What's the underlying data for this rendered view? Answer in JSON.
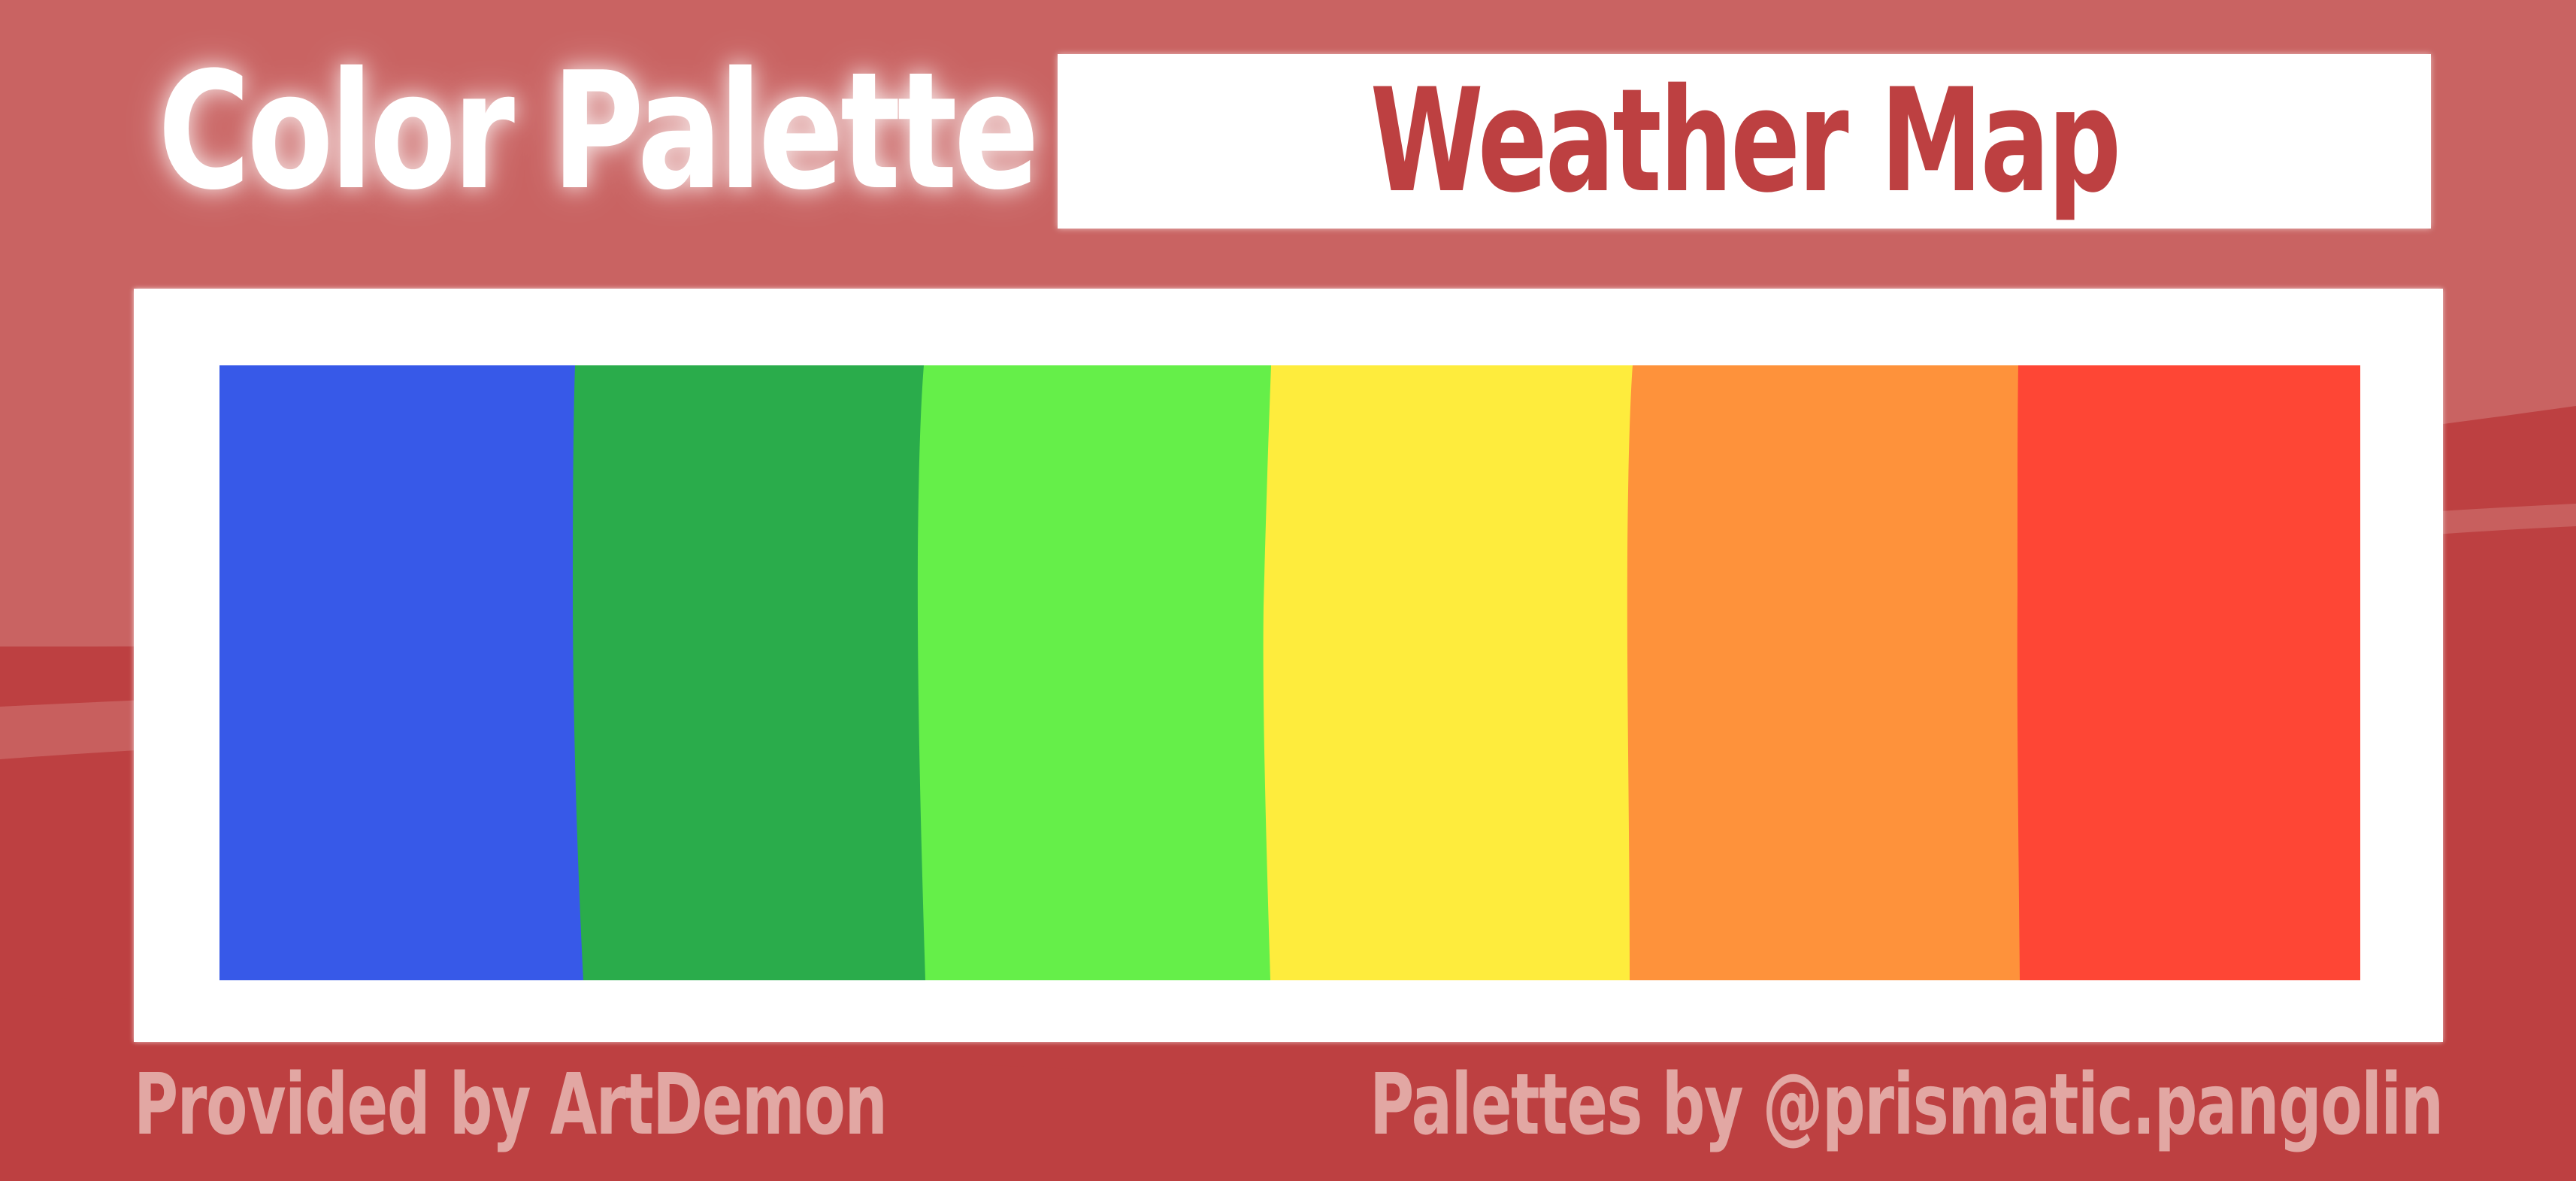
{
  "header": {
    "title": "Color Palette",
    "palette_name": "Weather Map"
  },
  "palette": {
    "swatches": [
      {
        "name": "blue",
        "color": "#3759e8"
      },
      {
        "name": "green",
        "color": "#2aac4b"
      },
      {
        "name": "light-green",
        "color": "#65ef49"
      },
      {
        "name": "yellow",
        "color": "#feec3d"
      },
      {
        "name": "orange",
        "color": "#fe923b"
      },
      {
        "name": "red",
        "color": "#fe4635"
      }
    ]
  },
  "footer": {
    "provider": "Provided by ArtDemon",
    "credit": "Palettes by @prismatic.pangolin"
  },
  "colors": {
    "background": "#c96362",
    "wave": "#bd4041",
    "frame": "#ffffff",
    "footer_text": "#e2a7a3"
  }
}
